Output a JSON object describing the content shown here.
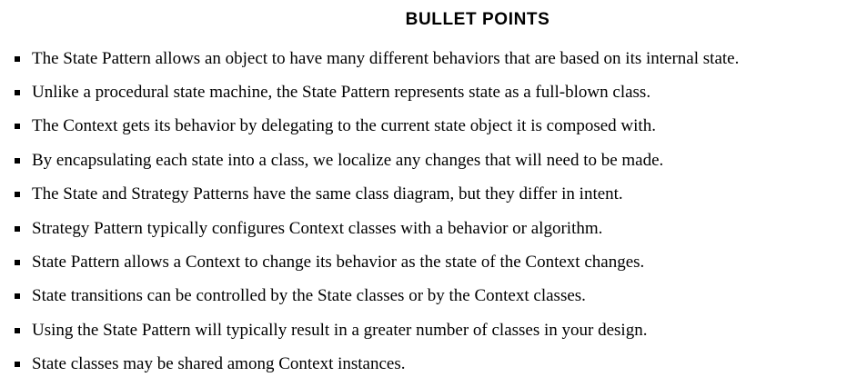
{
  "title": "BULLET POINTS",
  "bullets": [
    "The State Pattern allows an object to have many different behaviors that are based on its internal state.",
    "Unlike a procedural state machine, the State Pattern represents state as a full-blown class.",
    "The Context gets its behavior by delegating to the current state object it is composed with.",
    "By encapsulating each state into a class, we localize any changes that will need to be made.",
    "The State and Strategy Patterns have the same class diagram, but they differ in intent.",
    "Strategy Pattern typically configures Context classes with a behavior or algorithm.",
    "State Pattern allows a Context to change its behavior as the state of the Context changes.",
    "State transitions can be controlled by the State classes or by the Context classes.",
    "Using the State Pattern will typically result in a greater number of classes in your design.",
    "State classes may be shared among Context instances."
  ]
}
